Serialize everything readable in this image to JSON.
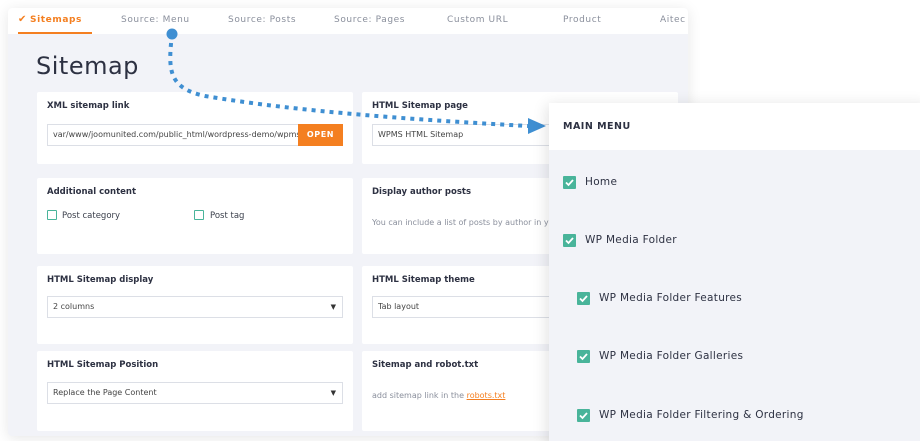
{
  "tabs": [
    {
      "label": "Sitemaps",
      "active": true
    },
    {
      "label": "Source: Menu"
    },
    {
      "label": "Source: Posts"
    },
    {
      "label": "Source: Pages"
    },
    {
      "label": "Custom URL"
    },
    {
      "label": "Product"
    },
    {
      "label": "Aitec"
    }
  ],
  "page_title": "Sitemap",
  "cards": {
    "xml_sitemap": {
      "label": "XML sitemap link",
      "value": "var/www/joomunited.com/public_html/wordpress-demo/wpms-s",
      "button": "OPEN"
    },
    "html_sitemap_page": {
      "label": "HTML Sitemap page",
      "value": "WPMS HTML Sitemap"
    },
    "additional_content": {
      "label": "Additional content",
      "options": [
        "Post category",
        "Post tag"
      ]
    },
    "display_author_posts": {
      "label": "Display author posts",
      "text": "You can include a list of posts by author in yo"
    },
    "html_sitemap_display": {
      "label": "HTML Sitemap display",
      "value": "2 columns"
    },
    "html_sitemap_theme": {
      "label": "HTML Sitemap theme",
      "value": "Tab layout"
    },
    "html_sitemap_position": {
      "label": "HTML Sitemap Position",
      "value": "Replace the Page Content"
    },
    "sitemap_robot": {
      "label": "Sitemap and robot.txt",
      "text": "add sitemap link in the ",
      "link": "robots.txt"
    }
  },
  "menu": {
    "title": "MAIN MENU",
    "items": [
      {
        "label": "Home",
        "checked": true
      },
      {
        "label": "WP Media Folder",
        "checked": true
      },
      {
        "label": "WP Media Folder Features",
        "checked": true
      },
      {
        "label": "WP Media Folder Galleries",
        "checked": true
      },
      {
        "label": "WP Media Folder Filtering & Ordering",
        "checked": true
      }
    ]
  },
  "colors": {
    "accent": "#f47f20",
    "check_green": "#49b49a",
    "panel_bg": "#f2f3f8",
    "arrow": "#3f8fd2"
  },
  "icons": [
    "check-icon",
    "select-arrow-icon",
    "checkbox-icon",
    "arrow-head-icon"
  ]
}
